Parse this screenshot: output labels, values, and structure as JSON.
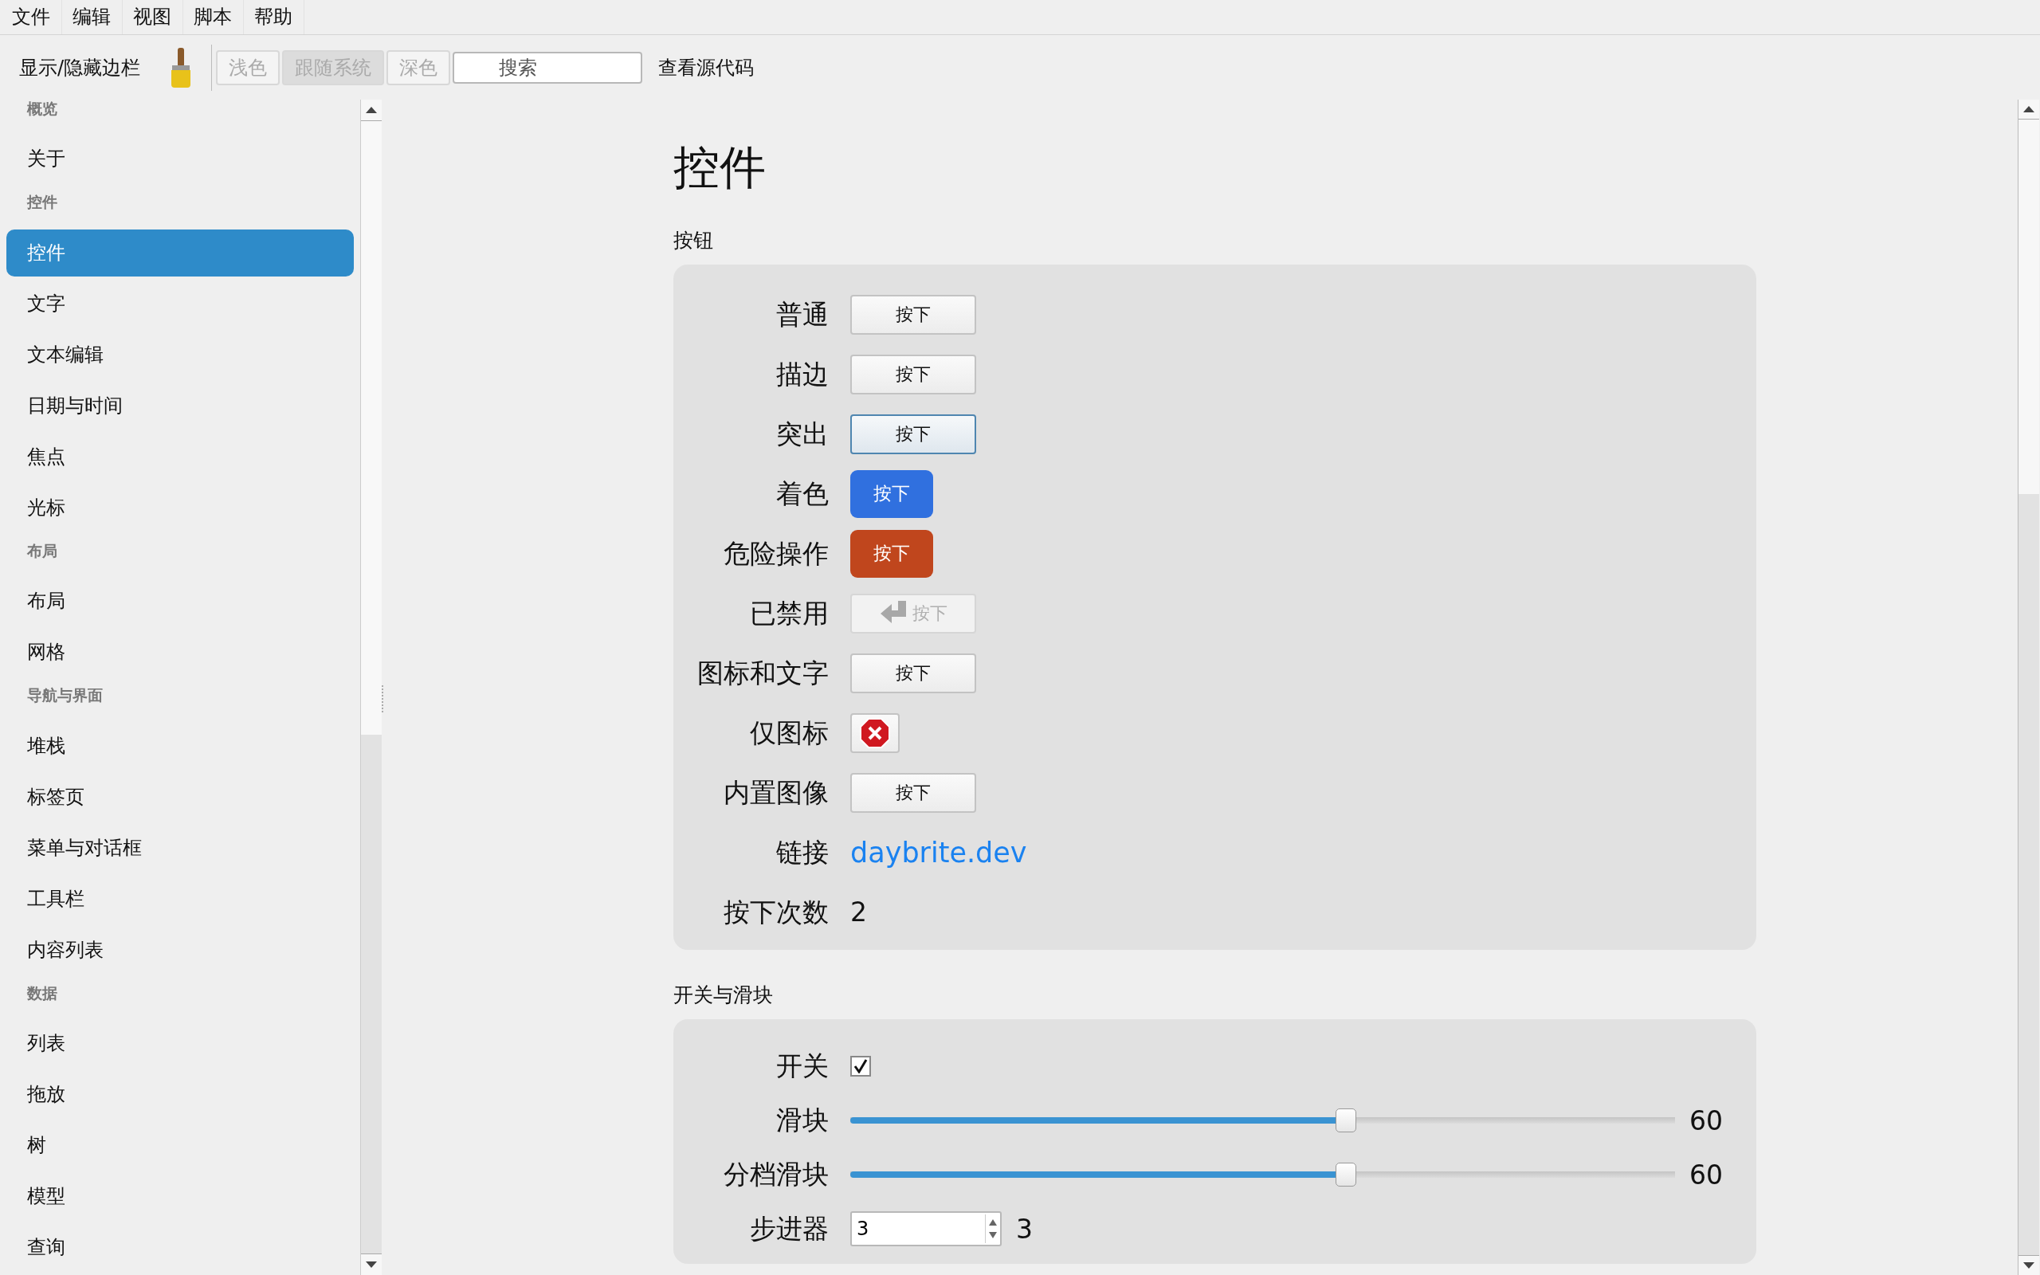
{
  "menu_bar": [
    {
      "label": "文件"
    },
    {
      "label": "编辑"
    },
    {
      "label": "视图"
    },
    {
      "label": "脚本"
    },
    {
      "label": "帮助"
    }
  ],
  "toolbar": {
    "sidebar_toggle": "显示/隐藏边栏",
    "theme_buttons": [
      {
        "label": "浅色",
        "selected": false
      },
      {
        "label": "跟随系统",
        "selected": true
      },
      {
        "label": "深色",
        "selected": false
      }
    ],
    "search": {
      "placeholder": "搜索"
    },
    "view_source": "查看源代码"
  },
  "sidebar": {
    "items": [
      {
        "kind": "header",
        "label": "概览"
      },
      {
        "kind": "item",
        "label": "关于",
        "selected": false
      },
      {
        "kind": "header",
        "label": "控件"
      },
      {
        "kind": "item",
        "label": "控件",
        "selected": true
      },
      {
        "kind": "item",
        "label": "文字",
        "selected": false
      },
      {
        "kind": "item",
        "label": "文本编辑",
        "selected": false
      },
      {
        "kind": "item",
        "label": "日期与时间",
        "selected": false
      },
      {
        "kind": "item",
        "label": "焦点",
        "selected": false
      },
      {
        "kind": "item",
        "label": "光标",
        "selected": false
      },
      {
        "kind": "header",
        "label": "布局"
      },
      {
        "kind": "item",
        "label": "布局",
        "selected": false
      },
      {
        "kind": "item",
        "label": "网格",
        "selected": false
      },
      {
        "kind": "header",
        "label": "导航与界面"
      },
      {
        "kind": "item",
        "label": "堆栈",
        "selected": false
      },
      {
        "kind": "item",
        "label": "标签页",
        "selected": false
      },
      {
        "kind": "item",
        "label": "菜单与对话框",
        "selected": false
      },
      {
        "kind": "item",
        "label": "工具栏",
        "selected": false
      },
      {
        "kind": "item",
        "label": "内容列表",
        "selected": false
      },
      {
        "kind": "header",
        "label": "数据"
      },
      {
        "kind": "item",
        "label": "列表",
        "selected": false
      },
      {
        "kind": "item",
        "label": "拖放",
        "selected": false
      },
      {
        "kind": "item",
        "label": "树",
        "selected": false
      },
      {
        "kind": "item",
        "label": "模型",
        "selected": false
      },
      {
        "kind": "item",
        "label": "查询",
        "selected": false
      }
    ]
  },
  "page": {
    "title": "控件",
    "sections": [
      {
        "title": "按钮",
        "rows": [
          {
            "label": "普通",
            "kind": "plain_button",
            "text": "按下"
          },
          {
            "label": "描边",
            "kind": "plain_button",
            "text": "按下"
          },
          {
            "label": "突出",
            "kind": "accent_button",
            "text": "按下"
          },
          {
            "label": "着色",
            "kind": "tinted_button",
            "text": "按下"
          },
          {
            "label": "危险操作",
            "kind": "danger_button",
            "text": "按下"
          },
          {
            "label": "已禁用",
            "kind": "icon_text_button",
            "disabled": true,
            "text": "按下"
          },
          {
            "label": "图标和文字",
            "kind": "plain_button",
            "text": "按下"
          },
          {
            "label": "仅图标",
            "kind": "icon_button"
          },
          {
            "label": "内置图像",
            "kind": "plain_button",
            "text": "按下"
          },
          {
            "label": "链接",
            "kind": "link",
            "text": "daybrite.dev"
          },
          {
            "label": "按下次数",
            "kind": "value",
            "text": "2"
          }
        ]
      },
      {
        "title": "开关与滑块",
        "rows": [
          {
            "label": "开关",
            "kind": "checkbox",
            "checked": true
          },
          {
            "label": "滑块",
            "kind": "slider",
            "level": 0.6,
            "reading": "60"
          },
          {
            "label": "分档滑块",
            "kind": "slider",
            "level": 0.6,
            "reading": "60"
          },
          {
            "label": "步进器",
            "kind": "stepper",
            "value": "3",
            "reading": "3"
          }
        ]
      }
    ]
  }
}
